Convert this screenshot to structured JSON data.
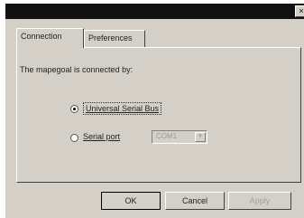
{
  "titlebar": {
    "close_label": "×"
  },
  "tabs": [
    {
      "label": "Connection",
      "active": true
    },
    {
      "label": "Preferences",
      "active": false
    }
  ],
  "connection": {
    "description": "The mapegoal is connected by:",
    "options": [
      {
        "label": "Universal Serial Bus",
        "selected": true
      },
      {
        "label": "Serial port",
        "selected": false
      }
    ],
    "port_select": {
      "value": "COM1",
      "enabled": false,
      "arrow": "▼"
    }
  },
  "buttons": {
    "ok": "OK",
    "cancel": "Cancel",
    "apply": "Apply"
  },
  "colors": {
    "titlebar": "#111111",
    "dialog_face": "#d4d0c8",
    "disabled_text": "#a0a0a0"
  }
}
